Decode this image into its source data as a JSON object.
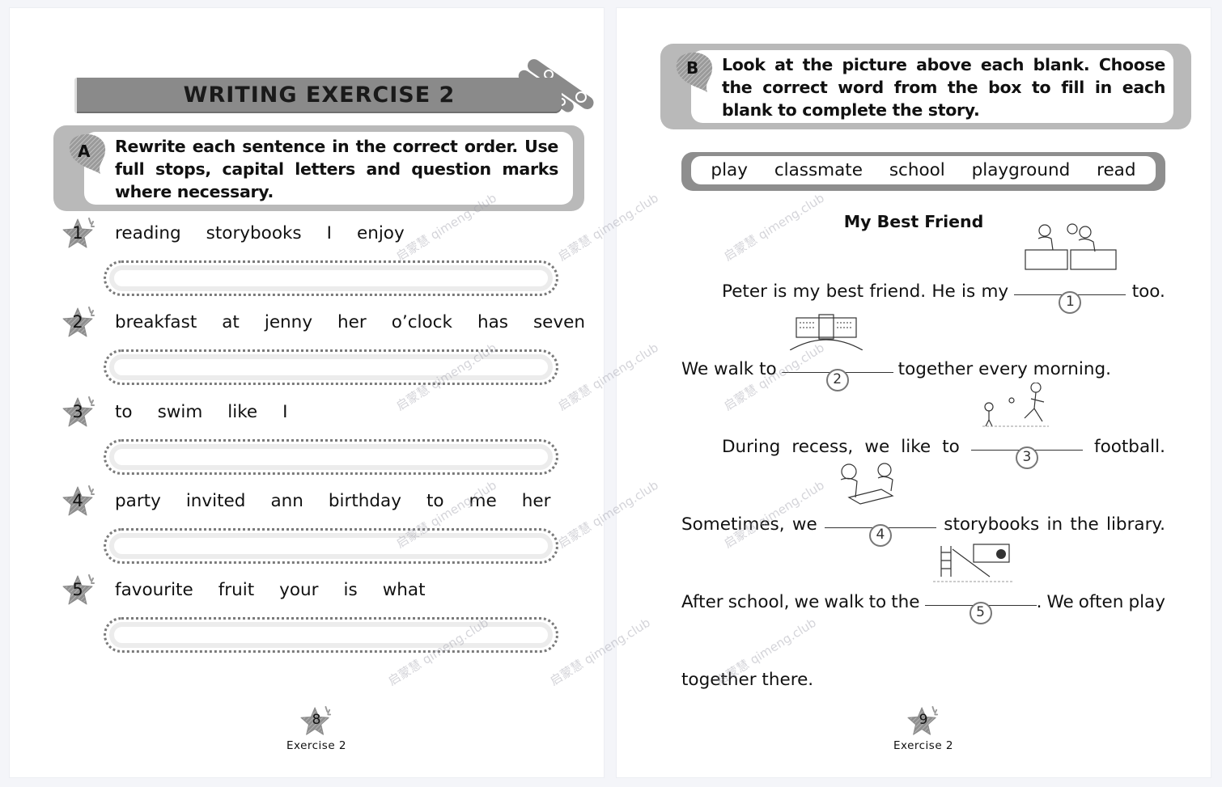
{
  "left_page": {
    "title": "WRITING EXERCISE 2",
    "section_a": {
      "letter": "A",
      "instruction": "Rewrite each sentence in the correct order. Use full stops, capital letters and question marks where necessary."
    },
    "questions": [
      {
        "number": "1",
        "words": [
          "reading",
          "storybooks",
          "I",
          "enjoy"
        ],
        "answer": ""
      },
      {
        "number": "2",
        "words": [
          "breakfast",
          "at",
          "jenny",
          "her",
          "o’clock",
          "has",
          "seven"
        ],
        "answer": ""
      },
      {
        "number": "3",
        "words": [
          "to",
          "swim",
          "like",
          "I"
        ],
        "answer": ""
      },
      {
        "number": "4",
        "words": [
          "party",
          "invited",
          "ann",
          "birthday",
          "to",
          "me",
          "her"
        ],
        "answer": ""
      },
      {
        "number": "5",
        "words": [
          "favourite",
          "fruit",
          "your",
          "is",
          "what"
        ],
        "answer": ""
      }
    ],
    "footer": {
      "page_number": "8",
      "label": "Exercise 2"
    }
  },
  "right_page": {
    "section_b": {
      "letter": "B",
      "instruction": "Look at the picture above each blank. Choose the correct word from the box to fill in each blank to complete the story."
    },
    "word_box": [
      "play",
      "classmate",
      "school",
      "playground",
      "read"
    ],
    "story_title": "My Best Friend",
    "story": [
      {
        "before": "Peter is my best friend. He is my",
        "blank": "1",
        "after": "too.",
        "picture": "classmates-at-desks"
      },
      {
        "before": "We walk to",
        "blank": "2",
        "after": "together every morning.",
        "picture": "school-building"
      },
      {
        "before": "During recess, we like to",
        "blank": "3",
        "after": "football.",
        "picture": "children-playing-football"
      },
      {
        "before": "Sometimes, we",
        "blank": "4",
        "after": "storybooks in the library.",
        "picture": "children-reading"
      },
      {
        "before": "After school, we walk to the",
        "blank": "5",
        "after": ". We often play",
        "picture": "playground"
      }
    ],
    "story_end": "together there.",
    "footer": {
      "page_number": "9",
      "label": "Exercise 2"
    }
  },
  "watermark": "启蒙慧  qimeng.club",
  "colors": {
    "banner_gray": "#8a8a8a",
    "box_gray": "#b9b9b9",
    "word_box_gray": "#8e8e8e",
    "background": "#f4f5f9"
  }
}
